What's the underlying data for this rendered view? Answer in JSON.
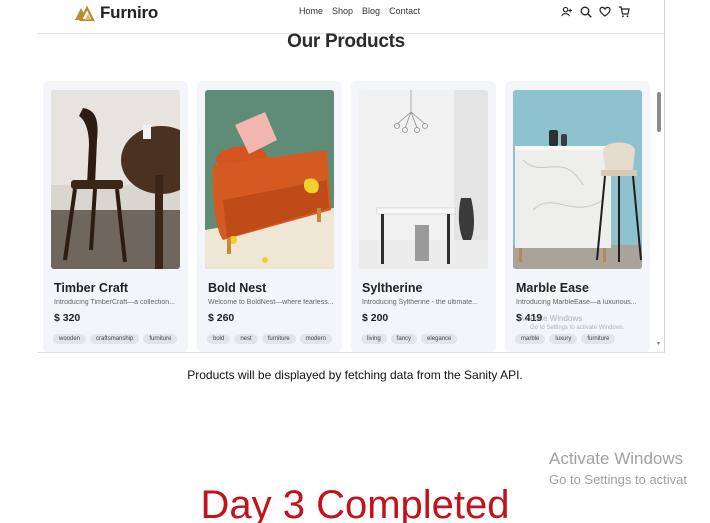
{
  "brand": {
    "name": "Furniro",
    "accent": "#b88e2f"
  },
  "nav": {
    "links": [
      "Home",
      "Shop",
      "Blog",
      "Contact"
    ],
    "icons": [
      "user-plus-icon",
      "search-icon",
      "heart-icon",
      "cart-icon"
    ]
  },
  "section": {
    "title": "Our Products"
  },
  "products": [
    {
      "name": "Timber Craft",
      "description": "Introducing TimberCraft—a collection...",
      "price": "$ 320",
      "tags": [
        "wooden",
        "craftsmanship",
        "furniture"
      ]
    },
    {
      "name": "Bold Nest",
      "description": "Welcome to BoldNest—where fearless...",
      "price": "$ 260",
      "tags": [
        "bold",
        "nest",
        "furniture",
        "modern"
      ]
    },
    {
      "name": "Syltherine",
      "description": "Introducing Syltherine - the ultimate...",
      "price": "$ 200",
      "tags": [
        "living",
        "fancy",
        "elegance"
      ]
    },
    {
      "name": "Marble Ease",
      "description": "Introducing MarbleEase—a luxurious...",
      "price": "$ 419",
      "tags": [
        "marble",
        "luxury",
        "furniture"
      ]
    }
  ],
  "inner_watermark": {
    "line1": "Activate Windows",
    "line2": "Go to Settings to activate Windows."
  },
  "caption": "Products will be displayed by fetching data from the Sanity API.",
  "watermark": {
    "line1": "Activate Windows",
    "line2": "Go to Settings to activat"
  },
  "headline": "Day 3 Completed"
}
